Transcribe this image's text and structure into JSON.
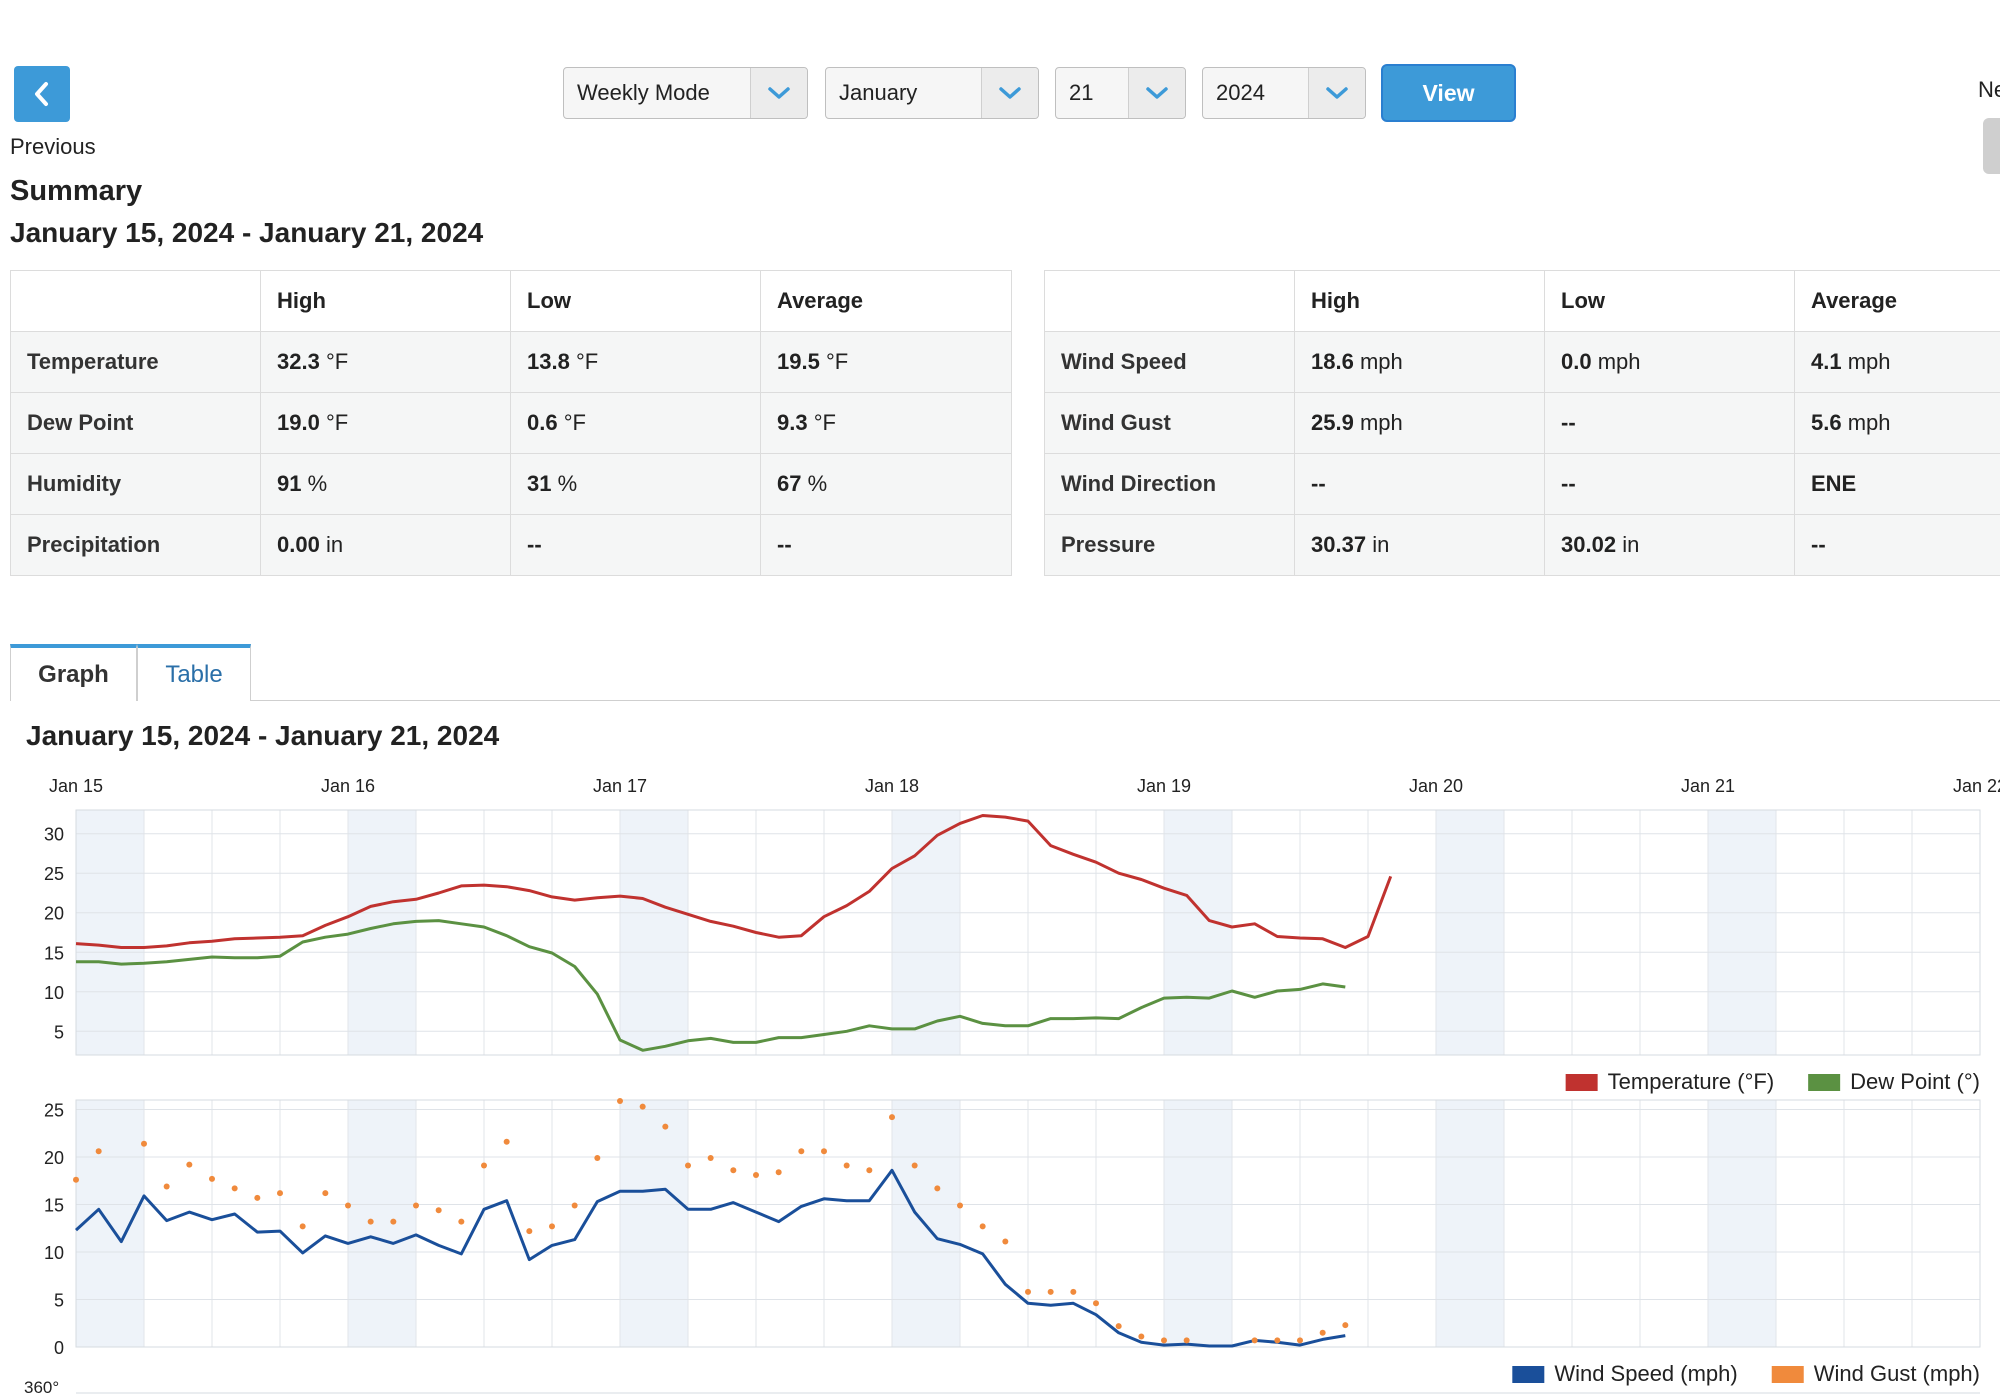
{
  "nav": {
    "previous_label": "Previous",
    "next_label": "Ne"
  },
  "controls": {
    "mode": "Weekly Mode",
    "month": "January",
    "day": "21",
    "year": "2024",
    "view_label": "View"
  },
  "summary": {
    "title": "Summary",
    "range": "January 15, 2024 - January 21, 2024",
    "left_table": {
      "headers": [
        "",
        "High",
        "Low",
        "Average"
      ],
      "rows": [
        {
          "label": "Temperature",
          "high": "32.3",
          "high_unit": "°F",
          "low": "13.8",
          "low_unit": "°F",
          "avg": "19.5",
          "avg_unit": "°F"
        },
        {
          "label": "Dew Point",
          "high": "19.0",
          "high_unit": "°F",
          "low": "0.6",
          "low_unit": "°F",
          "avg": "9.3",
          "avg_unit": "°F"
        },
        {
          "label": "Humidity",
          "high": "91",
          "high_unit": "%",
          "low": "31",
          "low_unit": "%",
          "avg": "67",
          "avg_unit": "%"
        },
        {
          "label": "Precipitation",
          "high": "0.00",
          "high_unit": "in",
          "low": "--",
          "low_unit": "",
          "avg": "--",
          "avg_unit": ""
        }
      ]
    },
    "right_table": {
      "headers": [
        "",
        "High",
        "Low",
        "Average"
      ],
      "rows": [
        {
          "label": "Wind Speed",
          "high": "18.6",
          "high_unit": "mph",
          "low": "0.0",
          "low_unit": "mph",
          "avg": "4.1",
          "avg_unit": "mph"
        },
        {
          "label": "Wind Gust",
          "high": "25.9",
          "high_unit": "mph",
          "low": "--",
          "low_unit": "",
          "avg": "5.6",
          "avg_unit": "mph"
        },
        {
          "label": "Wind Direction",
          "high": "--",
          "high_unit": "",
          "low": "--",
          "low_unit": "",
          "avg": "ENE",
          "avg_unit": ""
        },
        {
          "label": "Pressure",
          "high": "30.37",
          "high_unit": "in",
          "low": "30.02",
          "low_unit": "in",
          "avg": "--",
          "avg_unit": ""
        }
      ]
    }
  },
  "tabs": {
    "graph": "Graph",
    "table": "Table"
  },
  "graph": {
    "title": "January 15, 2024 - January 21, 2024",
    "next_axis_label": "360°"
  },
  "colors": {
    "accent": "#3d9ad8",
    "temperature": "#c0322f",
    "dew_point": "#5b9142",
    "wind_speed": "#1a4f9a",
    "wind_gust": "#f08a3c",
    "band": "#eef3f9"
  },
  "chart_data": [
    {
      "type": "line",
      "x_ticks": [
        "Jan 15",
        "Jan 16",
        "Jan 17",
        "Jan 18",
        "Jan 19",
        "Jan 20",
        "Jan 21",
        "Jan 22"
      ],
      "xlim_days": [
        0,
        7
      ],
      "ylim": [
        2,
        33
      ],
      "y_ticks": [
        5,
        10,
        15,
        20,
        25,
        30
      ],
      "grid": true,
      "legend": "bottom-right",
      "sample_step_hours": 2,
      "series": [
        {
          "name": "Temperature (°F)",
          "color": "#c0322f",
          "kind": "line",
          "values": [
            16.1,
            15.9,
            15.6,
            15.6,
            15.8,
            16.2,
            16.4,
            16.7,
            16.8,
            16.9,
            17.1,
            18.4,
            19.5,
            20.8,
            21.4,
            21.7,
            22.5,
            23.4,
            23.5,
            23.3,
            22.8,
            22.0,
            21.6,
            21.9,
            22.1,
            21.8,
            20.7,
            19.8,
            18.9,
            18.3,
            17.5,
            16.9,
            17.1,
            19.5,
            20.9,
            22.7,
            25.6,
            27.2,
            29.8,
            31.3,
            32.3,
            32.1,
            31.6,
            28.5,
            27.4,
            26.4,
            25.0,
            24.2,
            23.1,
            22.2,
            19.0,
            18.2,
            18.6,
            17.0,
            16.8,
            16.7,
            15.6,
            17.0,
            24.6
          ]
        },
        {
          "name": "Dew Point (°)",
          "color": "#5b9142",
          "kind": "line",
          "values": [
            13.8,
            13.8,
            13.5,
            13.6,
            13.8,
            14.1,
            14.4,
            14.3,
            14.3,
            14.5,
            16.3,
            16.9,
            17.3,
            18.0,
            18.6,
            18.9,
            19.0,
            18.6,
            18.2,
            17.1,
            15.7,
            14.9,
            13.2,
            9.7,
            3.9,
            2.6,
            3.1,
            3.8,
            4.1,
            3.6,
            3.6,
            4.2,
            4.2,
            4.6,
            5.0,
            5.7,
            5.3,
            5.3,
            6.3,
            6.9,
            6.0,
            5.7,
            5.7,
            6.6,
            6.6,
            6.7,
            6.6,
            8.0,
            9.2,
            9.3,
            9.2,
            10.1,
            9.3,
            10.1,
            10.3,
            11.0,
            10.6
          ]
        }
      ]
    },
    {
      "type": "line",
      "x_ticks": [
        "Jan 15",
        "Jan 16",
        "Jan 17",
        "Jan 18",
        "Jan 19",
        "Jan 20",
        "Jan 21",
        "Jan 22"
      ],
      "xlim_days": [
        0,
        7
      ],
      "ylim": [
        0,
        26
      ],
      "y_ticks": [
        0,
        5,
        10,
        15,
        20,
        25
      ],
      "grid": true,
      "legend": "bottom-right",
      "sample_step_hours": 2,
      "series": [
        {
          "name": "Wind Speed (mph)",
          "color": "#1a4f9a",
          "kind": "line",
          "values": [
            12.3,
            14.5,
            11.1,
            15.9,
            13.3,
            14.2,
            13.4,
            14.0,
            12.1,
            12.2,
            9.9,
            11.7,
            10.9,
            11.6,
            10.9,
            11.8,
            10.7,
            9.8,
            14.5,
            15.4,
            9.2,
            10.7,
            11.3,
            15.3,
            16.4,
            16.4,
            16.6,
            14.5,
            14.5,
            15.2,
            14.2,
            13.2,
            14.8,
            15.6,
            15.4,
            15.4,
            18.6,
            14.2,
            11.4,
            10.8,
            9.8,
            6.6,
            4.6,
            4.4,
            4.6,
            3.4,
            1.5,
            0.5,
            0.2,
            0.3,
            0.1,
            0.1,
            0.7,
            0.5,
            0.2,
            0.8,
            1.2
          ]
        },
        {
          "name": "Wind Gust (mph)",
          "color": "#f08a3c",
          "kind": "dots",
          "values": [
            17.6,
            20.6,
            null,
            21.4,
            16.9,
            19.2,
            17.7,
            16.7,
            15.7,
            16.2,
            12.7,
            16.2,
            14.9,
            13.2,
            13.2,
            14.9,
            14.4,
            13.2,
            19.1,
            21.6,
            12.2,
            12.7,
            14.9,
            19.9,
            25.9,
            25.3,
            23.2,
            19.1,
            19.9,
            18.6,
            18.1,
            18.4,
            20.6,
            20.6,
            19.1,
            18.6,
            24.2,
            19.1,
            16.7,
            14.9,
            12.7,
            11.1,
            5.8,
            5.8,
            5.8,
            4.6,
            2.2,
            1.1,
            0.7,
            0.7,
            null,
            null,
            0.7,
            0.7,
            0.7,
            1.5,
            2.3
          ]
        }
      ]
    }
  ]
}
